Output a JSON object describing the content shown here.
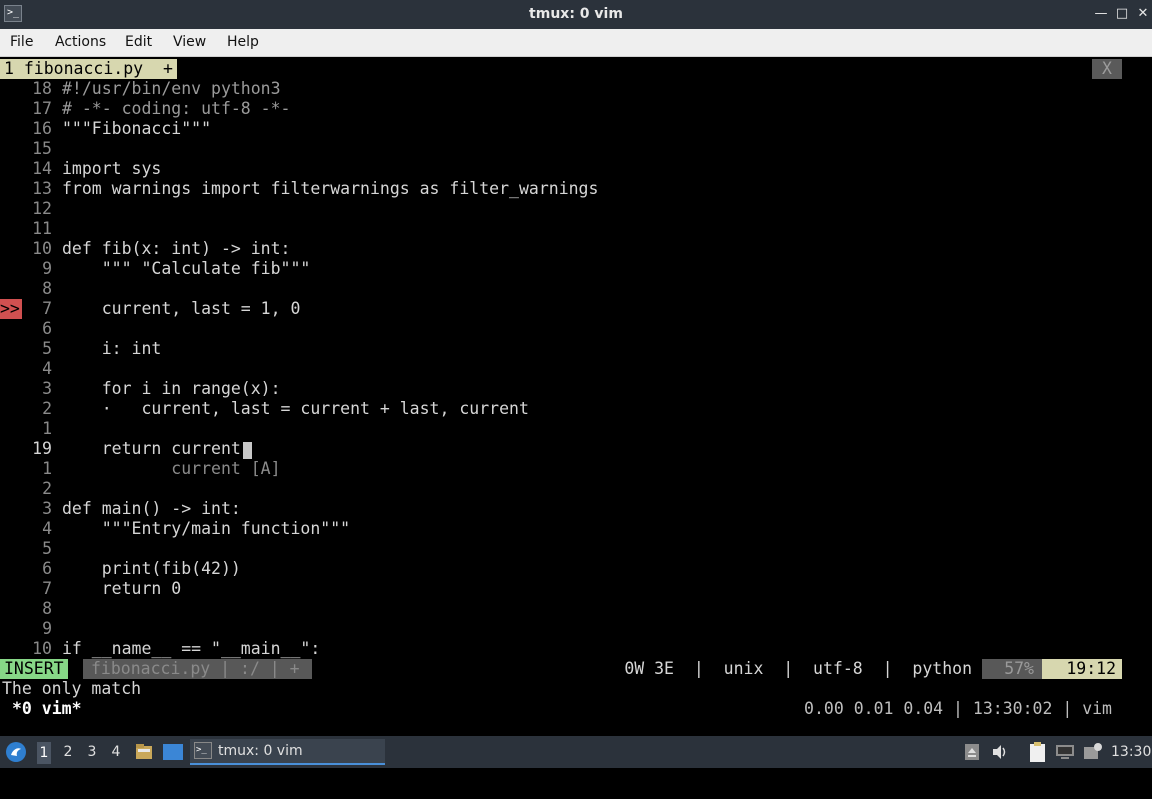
{
  "window": {
    "title": "tmux: 0 vim"
  },
  "menu": [
    "File",
    "Actions",
    "Edit",
    "View",
    "Help"
  ],
  "tabline": {
    "tab": "1 fibonacci.py  +",
    "close": "X"
  },
  "code_lines": [
    {
      "ln": "18",
      "text": "#!/usr/bin/env python3"
    },
    {
      "ln": "17",
      "text": "# -*- coding: utf-8 -*-"
    },
    {
      "ln": "16",
      "text": "\"\"\"Fibonacci\"\"\""
    },
    {
      "ln": "15",
      "text": ""
    },
    {
      "ln": "14",
      "text": "import sys"
    },
    {
      "ln": "13",
      "text": "from warnings import filterwarnings as filter_warnings"
    },
    {
      "ln": "12",
      "text": ""
    },
    {
      "ln": "11",
      "text": ""
    },
    {
      "ln": "10",
      "text": "def fib(x: int) -> int:"
    },
    {
      "ln": "9",
      "text": "    \"\"\" \"Calculate fib\"\"\""
    },
    {
      "ln": "8",
      "text": ""
    },
    {
      "ln": "7",
      "text": "    current, last = 1, 0"
    },
    {
      "ln": "6",
      "text": ""
    },
    {
      "ln": "5",
      "text": "    i: int"
    },
    {
      "ln": "4",
      "text": ""
    },
    {
      "ln": "3",
      "text": "    for i in range(x):"
    },
    {
      "ln": "2",
      "text": "    ·   current, last = current + last, current"
    },
    {
      "ln": "1",
      "text": ""
    },
    {
      "ln": "19",
      "text": "    return current"
    },
    {
      "ln": "1",
      "text": "           current [A]"
    },
    {
      "ln": "2",
      "text": ""
    },
    {
      "ln": "3",
      "text": "def main() -> int:"
    },
    {
      "ln": "4",
      "text": "    \"\"\"Entry/main function\"\"\""
    },
    {
      "ln": "5",
      "text": ""
    },
    {
      "ln": "6",
      "text": "    print(fib(42))"
    },
    {
      "ln": "7",
      "text": "    return 0"
    },
    {
      "ln": "8",
      "text": ""
    },
    {
      "ln": "9",
      "text": ""
    },
    {
      "ln": "10",
      "text": "if __name__ == \"__main__\":"
    }
  ],
  "sign": ">>",
  "statusline": {
    "mode": "INSERT",
    "file": "fibonacci.py | :/ | +",
    "info": "0W 3E  |  unix  |  utf-8  |  python",
    "percent": "57%",
    "position": "19:12"
  },
  "message": "The only match",
  "tmux": {
    "window": "*0 vim*",
    "status": "0.00 0.01 0.04 | 13:30:02 | vim"
  },
  "taskbar": {
    "workspaces": [
      "1",
      "2",
      "3",
      "4"
    ],
    "task_label": "tmux: 0 vim",
    "clock": "13:30"
  },
  "colors": {
    "insert_mode": "#87d787",
    "error_sign": "#d05050",
    "tab_active": "#d7d7af"
  }
}
